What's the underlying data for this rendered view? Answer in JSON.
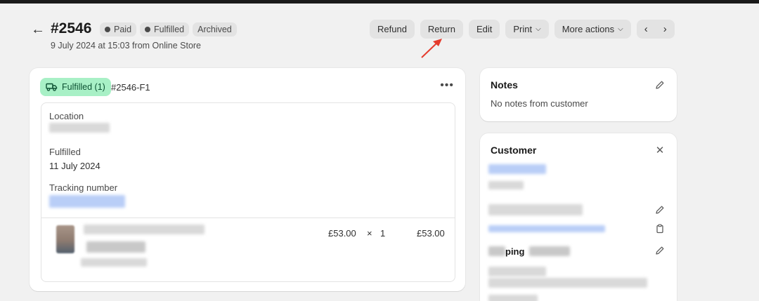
{
  "header": {
    "order_number": "#2546",
    "badges": [
      {
        "label": "Paid",
        "dot": true
      },
      {
        "label": "Fulfilled",
        "dot": true
      },
      {
        "label": "Archived",
        "dot": false
      }
    ],
    "subtitle": "9 July 2024 at 15:03 from Online Store"
  },
  "actions": {
    "refund": "Refund",
    "return": "Return",
    "edit": "Edit",
    "print": "Print",
    "more_actions": "More actions"
  },
  "fulfillment": {
    "badge_label": "Fulfilled (1)",
    "id": "#2546-F1",
    "location_label": "Location",
    "fulfilled_label": "Fulfilled",
    "fulfilled_date": "11 July 2024",
    "tracking_label": "Tracking number",
    "line_item": {
      "unit_price": "£53.00",
      "multiply": "×",
      "quantity": "1",
      "total": "£53.00"
    }
  },
  "notes": {
    "title": "Notes",
    "text": "No notes from customer"
  },
  "customer": {
    "title": "Customer",
    "shipping_fragment": "ping"
  },
  "colors": {
    "background": "#f1f1f1",
    "fulfilled_badge": "#a8f0c6",
    "annotation_arrow": "#e53b2c"
  }
}
